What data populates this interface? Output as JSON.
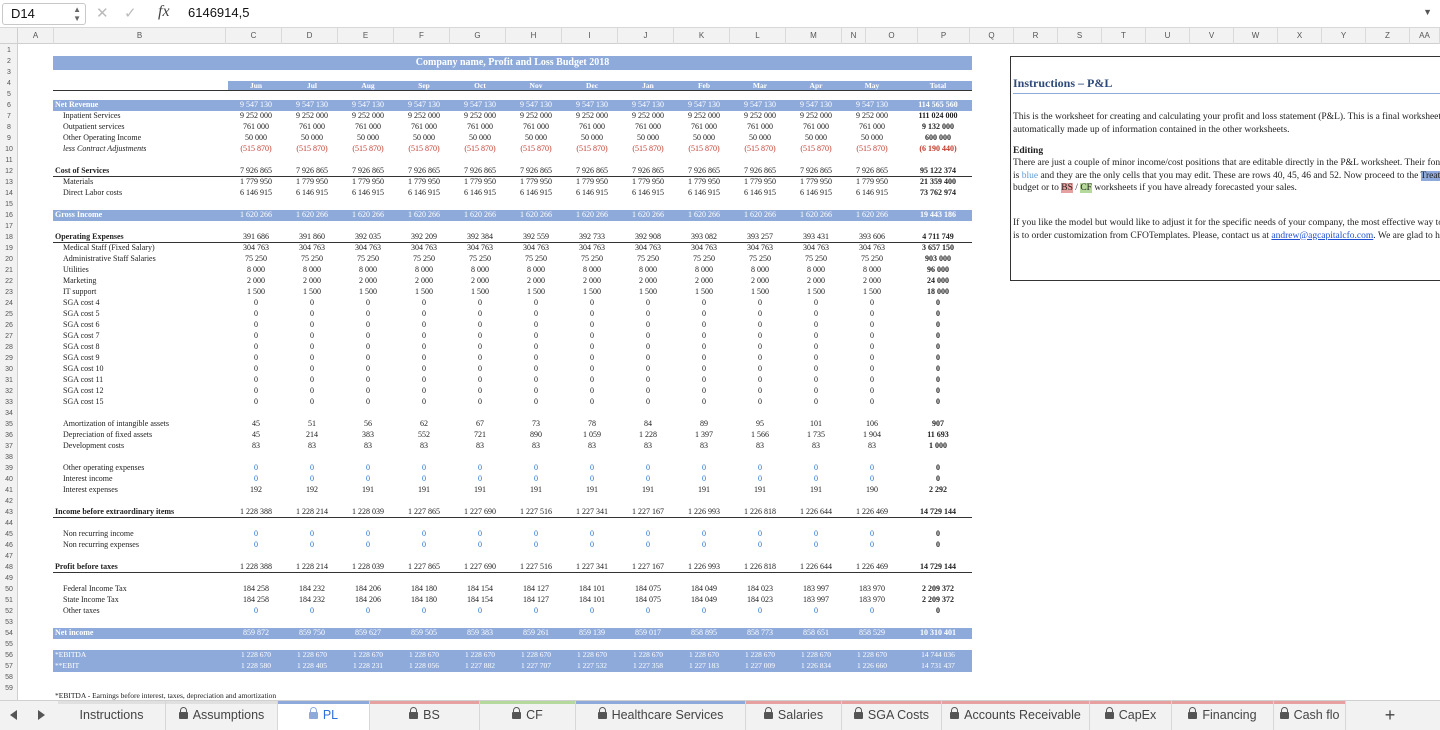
{
  "formula_bar": {
    "cell_ref": "D14",
    "fx": "fx",
    "value": "6146914,5"
  },
  "columns": [
    "A",
    "B",
    "C",
    "D",
    "E",
    "F",
    "G",
    "H",
    "I",
    "J",
    "K",
    "L",
    "M",
    "N",
    "O",
    "P",
    "Q",
    "R",
    "S",
    "T",
    "U",
    "V",
    "W",
    "X",
    "Y",
    "Z",
    "AA"
  ],
  "rows": [
    "1",
    "2",
    "3",
    "4",
    "5",
    "6",
    "7",
    "8",
    "9",
    "10",
    "11",
    "12",
    "13",
    "14",
    "15",
    "16",
    "17",
    "18",
    "19",
    "20",
    "21",
    "22",
    "23",
    "24",
    "25",
    "26",
    "27",
    "28",
    "29",
    "30",
    "31",
    "32",
    "33",
    "34",
    "35",
    "36",
    "37",
    "38",
    "39",
    "40",
    "41",
    "42",
    "43",
    "44",
    "45",
    "46",
    "47",
    "48",
    "49",
    "50",
    "51",
    "52",
    "53",
    "54",
    "55",
    "56",
    "57",
    "58",
    "59"
  ],
  "sheet": {
    "title": "Company name, Profit and Loss Budget 2018",
    "months": [
      "Jun",
      "Jul",
      "Aug",
      "Sep",
      "Oct",
      "Nov",
      "Dec",
      "Jan",
      "Feb",
      "Mar",
      "Apr",
      "May",
      "Total"
    ],
    "lines": [
      {
        "row": 6,
        "label": "Net Revenue",
        "style": "bar",
        "values": [
          "9 547 130",
          "9 547 130",
          "9 547 130",
          "9 547 130",
          "9 547 130",
          "9 547 130",
          "9 547 130",
          "9 547 130",
          "9 547 130",
          "9 547 130",
          "9 547 130",
          "9 547 130",
          "114 565 560"
        ]
      },
      {
        "row": 7,
        "label": "Inpatient Services",
        "indent": true,
        "values": [
          "9 252 000",
          "9 252 000",
          "9 252 000",
          "9 252 000",
          "9 252 000",
          "9 252 000",
          "9 252 000",
          "9 252 000",
          "9 252 000",
          "9 252 000",
          "9 252 000",
          "9 252 000",
          "111 024 000"
        ]
      },
      {
        "row": 8,
        "label": "Outpatient services",
        "indent": true,
        "values": [
          "761 000",
          "761 000",
          "761 000",
          "761 000",
          "761 000",
          "761 000",
          "761 000",
          "761 000",
          "761 000",
          "761 000",
          "761 000",
          "761 000",
          "9 132 000"
        ]
      },
      {
        "row": 9,
        "label": "Other Operating Income",
        "indent": true,
        "values": [
          "50 000",
          "50 000",
          "50 000",
          "50 000",
          "50 000",
          "50 000",
          "50 000",
          "50 000",
          "50 000",
          "50 000",
          "50 000",
          "50 000",
          "600 000"
        ]
      },
      {
        "row": 10,
        "label": "less Contract Adjustments",
        "indent": true,
        "italic": true,
        "red": true,
        "values": [
          "(515 870)",
          "(515 870)",
          "(515 870)",
          "(515 870)",
          "(515 870)",
          "(515 870)",
          "(515 870)",
          "(515 870)",
          "(515 870)",
          "(515 870)",
          "(515 870)",
          "(515 870)",
          "(6 190 440)"
        ]
      },
      {
        "row": 12,
        "label": "Cost of Services",
        "style": "uline",
        "values": [
          "7 926 865",
          "7 926 865",
          "7 926 865",
          "7 926 865",
          "7 926 865",
          "7 926 865",
          "7 926 865",
          "7 926 865",
          "7 926 865",
          "7 926 865",
          "7 926 865",
          "7 926 865",
          "95 122 374"
        ]
      },
      {
        "row": 13,
        "label": "Materials",
        "indent": true,
        "values": [
          "1 779 950",
          "1 779 950",
          "1 779 950",
          "1 779 950",
          "1 779 950",
          "1 779 950",
          "1 779 950",
          "1 779 950",
          "1 779 950",
          "1 779 950",
          "1 779 950",
          "1 779 950",
          "21 359 400"
        ]
      },
      {
        "row": 14,
        "label": "Direct Labor costs",
        "indent": true,
        "values": [
          "6 146 915",
          "6 146 915",
          "6 146 915",
          "6 146 915",
          "6 146 915",
          "6 146 915",
          "6 146 915",
          "6 146 915",
          "6 146 915",
          "6 146 915",
          "6 146 915",
          "6 146 915",
          "73 762 974"
        ]
      },
      {
        "row": 16,
        "label": "Gross Income",
        "style": "bar",
        "values": [
          "1 620 266",
          "1 620 266",
          "1 620 266",
          "1 620 266",
          "1 620 266",
          "1 620 266",
          "1 620 266",
          "1 620 266",
          "1 620 266",
          "1 620 266",
          "1 620 266",
          "1 620 266",
          "19 443 186"
        ]
      },
      {
        "row": 18,
        "label": "Operating Expenses",
        "style": "uline",
        "values": [
          "391 686",
          "391 860",
          "392 035",
          "392 209",
          "392 384",
          "392 559",
          "392 733",
          "392 908",
          "393 082",
          "393 257",
          "393 431",
          "393 606",
          "4 711 749"
        ]
      },
      {
        "row": 19,
        "label": "Medical Staff (Fixed Salary)",
        "indent": true,
        "values": [
          "304 763",
          "304 763",
          "304 763",
          "304 763",
          "304 763",
          "304 763",
          "304 763",
          "304 763",
          "304 763",
          "304 763",
          "304 763",
          "304 763",
          "3 657 150"
        ]
      },
      {
        "row": 20,
        "label": "Administrative Staff Salaries",
        "indent": true,
        "values": [
          "75 250",
          "75 250",
          "75 250",
          "75 250",
          "75 250",
          "75 250",
          "75 250",
          "75 250",
          "75 250",
          "75 250",
          "75 250",
          "75 250",
          "903 000"
        ]
      },
      {
        "row": 21,
        "label": "Utilities",
        "indent": true,
        "values": [
          "8 000",
          "8 000",
          "8 000",
          "8 000",
          "8 000",
          "8 000",
          "8 000",
          "8 000",
          "8 000",
          "8 000",
          "8 000",
          "8 000",
          "96 000"
        ]
      },
      {
        "row": 22,
        "label": "Marketing",
        "indent": true,
        "values": [
          "2 000",
          "2 000",
          "2 000",
          "2 000",
          "2 000",
          "2 000",
          "2 000",
          "2 000",
          "2 000",
          "2 000",
          "2 000",
          "2 000",
          "24 000"
        ]
      },
      {
        "row": 23,
        "label": "IT support",
        "indent": true,
        "values": [
          "1 500",
          "1 500",
          "1 500",
          "1 500",
          "1 500",
          "1 500",
          "1 500",
          "1 500",
          "1 500",
          "1 500",
          "1 500",
          "1 500",
          "18 000"
        ]
      },
      {
        "row": 24,
        "label": "SGA cost 4",
        "indent": true,
        "values": [
          "0",
          "0",
          "0",
          "0",
          "0",
          "0",
          "0",
          "0",
          "0",
          "0",
          "0",
          "0",
          "0"
        ]
      },
      {
        "row": 25,
        "label": "SGA cost 5",
        "indent": true,
        "values": [
          "0",
          "0",
          "0",
          "0",
          "0",
          "0",
          "0",
          "0",
          "0",
          "0",
          "0",
          "0",
          "0"
        ]
      },
      {
        "row": 26,
        "label": "SGA cost 6",
        "indent": true,
        "values": [
          "0",
          "0",
          "0",
          "0",
          "0",
          "0",
          "0",
          "0",
          "0",
          "0",
          "0",
          "0",
          "0"
        ]
      },
      {
        "row": 27,
        "label": "SGA cost 7",
        "indent": true,
        "values": [
          "0",
          "0",
          "0",
          "0",
          "0",
          "0",
          "0",
          "0",
          "0",
          "0",
          "0",
          "0",
          "0"
        ]
      },
      {
        "row": 28,
        "label": "SGA cost 8",
        "indent": true,
        "values": [
          "0",
          "0",
          "0",
          "0",
          "0",
          "0",
          "0",
          "0",
          "0",
          "0",
          "0",
          "0",
          "0"
        ]
      },
      {
        "row": 29,
        "label": "SGA cost 9",
        "indent": true,
        "values": [
          "0",
          "0",
          "0",
          "0",
          "0",
          "0",
          "0",
          "0",
          "0",
          "0",
          "0",
          "0",
          "0"
        ]
      },
      {
        "row": 30,
        "label": "SGA cost 10",
        "indent": true,
        "values": [
          "0",
          "0",
          "0",
          "0",
          "0",
          "0",
          "0",
          "0",
          "0",
          "0",
          "0",
          "0",
          "0"
        ]
      },
      {
        "row": 31,
        "label": "SGA cost 11",
        "indent": true,
        "values": [
          "0",
          "0",
          "0",
          "0",
          "0",
          "0",
          "0",
          "0",
          "0",
          "0",
          "0",
          "0",
          "0"
        ]
      },
      {
        "row": 32,
        "label": "SGA cost 12",
        "indent": true,
        "values": [
          "0",
          "0",
          "0",
          "0",
          "0",
          "0",
          "0",
          "0",
          "0",
          "0",
          "0",
          "0",
          "0"
        ]
      },
      {
        "row": 33,
        "label": "SGA cost 15",
        "indent": true,
        "values": [
          "0",
          "0",
          "0",
          "0",
          "0",
          "0",
          "0",
          "0",
          "0",
          "0",
          "0",
          "0",
          "0"
        ]
      },
      {
        "row": 35,
        "label": "Amortization of intangible assets",
        "indent": true,
        "values": [
          "45",
          "51",
          "56",
          "62",
          "67",
          "73",
          "78",
          "84",
          "89",
          "95",
          "101",
          "106",
          "907"
        ]
      },
      {
        "row": 36,
        "label": "Depreciation of fixed assets",
        "indent": true,
        "values": [
          "45",
          "214",
          "383",
          "552",
          "721",
          "890",
          "1 059",
          "1 228",
          "1 397",
          "1 566",
          "1 735",
          "1 904",
          "11 693"
        ]
      },
      {
        "row": 37,
        "label": "Development costs",
        "indent": true,
        "values": [
          "83",
          "83",
          "83",
          "83",
          "83",
          "83",
          "83",
          "83",
          "83",
          "83",
          "83",
          "83",
          "1 000"
        ]
      },
      {
        "row": 39,
        "label": "Other operating expenses",
        "indent": true,
        "blue": true,
        "values": [
          "0",
          "0",
          "0",
          "0",
          "0",
          "0",
          "0",
          "0",
          "0",
          "0",
          "0",
          "0",
          "0"
        ]
      },
      {
        "row": 40,
        "label": "Interest income",
        "indent": true,
        "blue": true,
        "values": [
          "0",
          "0",
          "0",
          "0",
          "0",
          "0",
          "0",
          "0",
          "0",
          "0",
          "0",
          "0",
          "0"
        ]
      },
      {
        "row": 41,
        "label": "Interest expenses",
        "indent": true,
        "values": [
          "192",
          "192",
          "191",
          "191",
          "191",
          "191",
          "191",
          "191",
          "191",
          "191",
          "191",
          "190",
          "2 292"
        ]
      },
      {
        "row": 43,
        "label": "Income before extraordinary items",
        "style": "uline",
        "values": [
          "1 228 388",
          "1 228 214",
          "1 228 039",
          "1 227 865",
          "1 227 690",
          "1 227 516",
          "1 227 341",
          "1 227 167",
          "1 226 993",
          "1 226 818",
          "1 226 644",
          "1 226 469",
          "14 729 144"
        ]
      },
      {
        "row": 45,
        "label": "Non recurring income",
        "indent": true,
        "blue": true,
        "values": [
          "0",
          "0",
          "0",
          "0",
          "0",
          "0",
          "0",
          "0",
          "0",
          "0",
          "0",
          "0",
          "0"
        ]
      },
      {
        "row": 46,
        "label": "Non recurring expenses",
        "indent": true,
        "blue": true,
        "values": [
          "0",
          "0",
          "0",
          "0",
          "0",
          "0",
          "0",
          "0",
          "0",
          "0",
          "0",
          "0",
          "0"
        ]
      },
      {
        "row": 48,
        "label": "Profit before taxes",
        "style": "uline",
        "values": [
          "1 228 388",
          "1 228 214",
          "1 228 039",
          "1 227 865",
          "1 227 690",
          "1 227 516",
          "1 227 341",
          "1 227 167",
          "1 226 993",
          "1 226 818",
          "1 226 644",
          "1 226 469",
          "14 729 144"
        ]
      },
      {
        "row": 50,
        "label": "Federal Income Tax",
        "indent": true,
        "values": [
          "184 258",
          "184 232",
          "184 206",
          "184 180",
          "184 154",
          "184 127",
          "184 101",
          "184 075",
          "184 049",
          "184 023",
          "183 997",
          "183 970",
          "2 209 372"
        ]
      },
      {
        "row": 51,
        "label": "State Income Tax",
        "indent": true,
        "values": [
          "184 258",
          "184 232",
          "184 206",
          "184 180",
          "184 154",
          "184 127",
          "184 101",
          "184 075",
          "184 049",
          "184 023",
          "183 997",
          "183 970",
          "2 209 372"
        ]
      },
      {
        "row": 52,
        "label": "Other taxes",
        "indent": true,
        "blue": true,
        "values": [
          "0",
          "0",
          "0",
          "0",
          "0",
          "0",
          "0",
          "0",
          "0",
          "0",
          "0",
          "0",
          "0"
        ]
      },
      {
        "row": 54,
        "label": "Net income",
        "style": "bar",
        "values": [
          "859 872",
          "859 750",
          "859 627",
          "859 505",
          "859 383",
          "859 261",
          "859 139",
          "859 017",
          "858 895",
          "858 773",
          "858 651",
          "858 529",
          "10 310 401"
        ]
      },
      {
        "row": 56,
        "label": "*EBITDA",
        "style": "bar2",
        "values": [
          "1 228 670",
          "1 228 670",
          "1 228 670",
          "1 228 670",
          "1 228 670",
          "1 228 670",
          "1 228 670",
          "1 228 670",
          "1 228 670",
          "1 228 670",
          "1 228 670",
          "1 228 670",
          "14 744 036"
        ]
      },
      {
        "row": 57,
        "label": "**EBIT",
        "style": "bar2",
        "values": [
          "1 228 580",
          "1 228 405",
          "1 228 231",
          "1 228 056",
          "1 227 882",
          "1 227 707",
          "1 227 532",
          "1 227 358",
          "1 227 183",
          "1 227 009",
          "1 226 834",
          "1 226 660",
          "14 731 437"
        ]
      }
    ],
    "footnote": "*EBITDA - Earnings before interest, taxes, depreciation and amortization"
  },
  "instructions": {
    "title": "Instructions – P&L",
    "p1": "This is the worksheet  for creating and calculating your profit and loss statement (P&L). This is a final worksheet that is automatically made up of information contained in the other worksheets.",
    "editing_title": "Editing",
    "p2_a": "There are just a couple of minor income/cost positions that are editable directly in the P&L worksheet. Their font color is ",
    "p2_blue": "blue",
    "p2_b": " and they are the only cells that you may edit. These are rows 40, 45, 46 and 52. Now proceed to the ",
    "p2_treat": "Treatments",
    "p2_c": " budget or to ",
    "p2_bs": "BS",
    "p2_slash": " / ",
    "p2_cf": "CF",
    "p2_d": " worksheets if you have already forecasted your sales.",
    "p3_a": "If you like the model but would like to adjust it for the specific needs of your company, the most effective way to do so is to order customization from CFOTemplates. Please, contact us at ",
    "p3_link": "andrew@agcapitalcfo.com",
    "p3_b": ". We are glad to help."
  },
  "tabs": [
    {
      "label": "Instructions",
      "locked": false,
      "active": false,
      "color": "#e0e0e0"
    },
    {
      "label": "Assumptions",
      "locked": true,
      "active": false,
      "color": "#e0e0e0"
    },
    {
      "label": "PL",
      "locked": true,
      "active": true,
      "color": "#8eaadb"
    },
    {
      "label": "BS",
      "locked": true,
      "active": false,
      "color": "#e6a0a0"
    },
    {
      "label": "CF",
      "locked": true,
      "active": false,
      "color": "#b5d99c"
    },
    {
      "label": "Healthcare Services",
      "locked": true,
      "active": false,
      "color": "#8eaadb"
    },
    {
      "label": "Salaries",
      "locked": true,
      "active": false,
      "color": "#e6a0a0"
    },
    {
      "label": "SGA Costs",
      "locked": true,
      "active": false,
      "color": "#e6a0a0"
    },
    {
      "label": "Accounts Receivable",
      "locked": true,
      "active": false,
      "color": "#e6a0a0"
    },
    {
      "label": "CapEx",
      "locked": true,
      "active": false,
      "color": "#e6a0a0"
    },
    {
      "label": "Financing",
      "locked": true,
      "active": false,
      "color": "#e6a0a0"
    },
    {
      "label": "Cash flo",
      "locked": true,
      "active": false,
      "color": "#e6a0a0"
    }
  ],
  "add_sheet": "+"
}
